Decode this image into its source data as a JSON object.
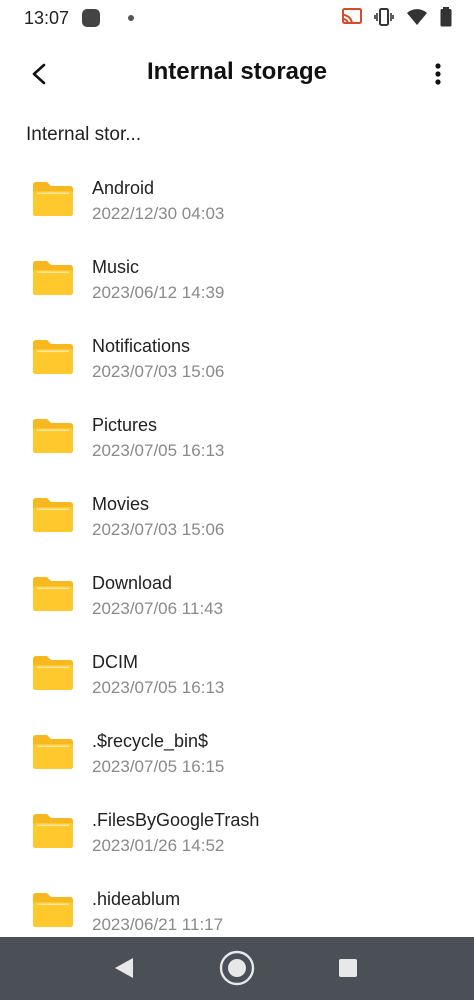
{
  "status": {
    "time": "13:07"
  },
  "app_bar": {
    "title": "Internal storage"
  },
  "breadcrumb": "Internal stor...",
  "folders": [
    {
      "name": "Android",
      "date": "2022/12/30 04:03"
    },
    {
      "name": "Music",
      "date": "2023/06/12 14:39"
    },
    {
      "name": "Notifications",
      "date": "2023/07/03 15:06"
    },
    {
      "name": "Pictures",
      "date": "2023/07/05 16:13"
    },
    {
      "name": "Movies",
      "date": "2023/07/03 15:06"
    },
    {
      "name": "Download",
      "date": "2023/07/06 11:43"
    },
    {
      "name": "DCIM",
      "date": "2023/07/05 16:13"
    },
    {
      "name": ".$recycle_bin$",
      "date": "2023/07/05 16:15"
    },
    {
      "name": ".FilesByGoogleTrash",
      "date": "2023/01/26 14:52"
    },
    {
      "name": ".hideablum",
      "date": "2023/06/21 11:17"
    }
  ],
  "colors": {
    "folder": "#FFC82C",
    "folder_tab": "#F7B81F",
    "nav_bar": "#4a5055"
  }
}
